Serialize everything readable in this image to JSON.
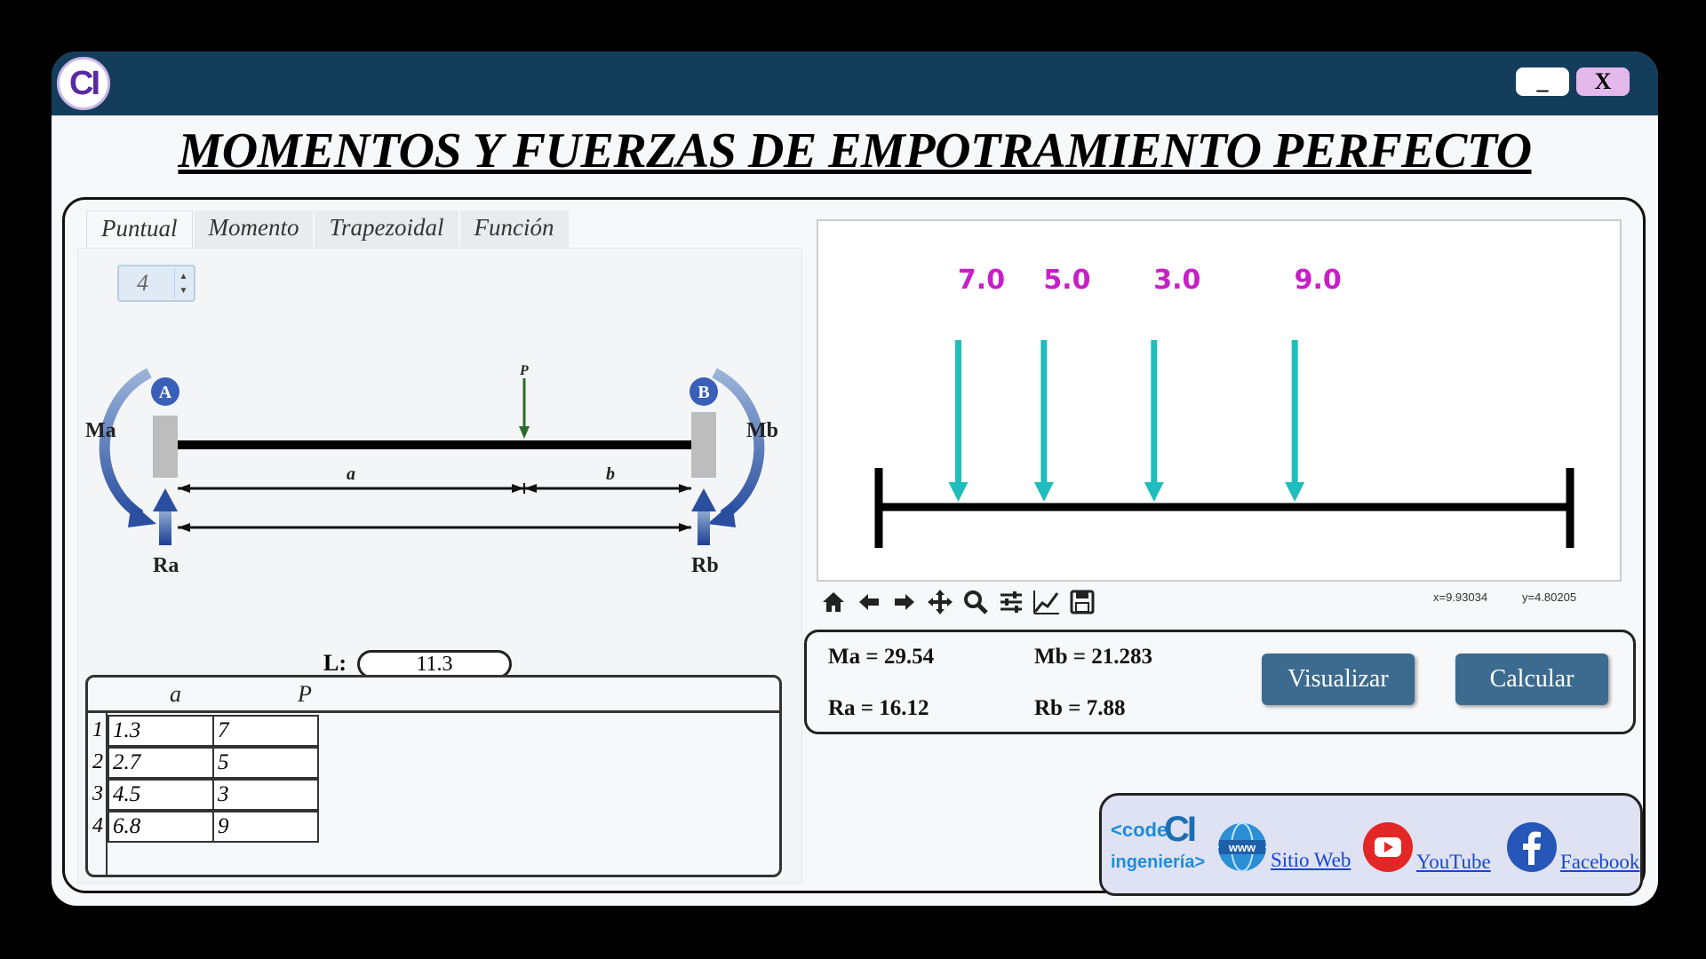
{
  "window": {
    "logo_text": "CI",
    "min_label": "_",
    "close_label": "X"
  },
  "title": "MOMENTOS Y FUERZAS DE EMPOTRAMIENTO PERFECTO",
  "tabs": [
    "Puntual",
    "Momento",
    "Trapezoidal",
    "Función"
  ],
  "active_tab": "Puntual",
  "spinbox": {
    "value": "4"
  },
  "diagram": {
    "support_a": "A",
    "support_b": "B",
    "moment_a": "Ma",
    "moment_b": "Mb",
    "reaction_a": "Ra",
    "reaction_b": "Rb",
    "load_label": "P",
    "dim_a": "a",
    "dim_b": "b",
    "length_label": "L:",
    "length_value": "11.3"
  },
  "table": {
    "headers": [
      "a",
      "P"
    ],
    "rows": [
      {
        "num": "1",
        "a": "1.3",
        "p": "7"
      },
      {
        "num": "2",
        "a": "2.7",
        "p": "5"
      },
      {
        "num": "3",
        "a": "4.5",
        "p": "3"
      },
      {
        "num": "4",
        "a": "6.8",
        "p": "9"
      }
    ]
  },
  "plot": {
    "beam_length": 11.3,
    "loads": [
      {
        "x": 1.3,
        "label": "7.0"
      },
      {
        "x": 2.7,
        "label": "5.0"
      },
      {
        "x": 4.5,
        "label": "3.0"
      },
      {
        "x": 6.8,
        "label": "9.0"
      }
    ],
    "load_color": "#1fbdbd",
    "label_color": "#c81ec8",
    "coord_x": "x=9.93034",
    "coord_y": "y=4.80205"
  },
  "toolbar": [
    "home-icon",
    "back-arrow-icon",
    "forward-arrow-icon",
    "pan-icon",
    "zoom-icon",
    "configure-icon",
    "line-edit-icon",
    "save-icon"
  ],
  "results": {
    "ma": "Ma = 29.54",
    "mb": "Mb = 21.283",
    "ra": "Ra = 16.12",
    "rb": "Rb = 7.88",
    "visualize_label": "Visualizar",
    "calculate_label": "Calcular"
  },
  "social": {
    "brand_top": "<code",
    "brand_ci": "CI",
    "brand_bottom": "ingeniería>",
    "website_label": "Sitio Web",
    "youtube_label": "YouTube",
    "facebook_label": "Facebook"
  }
}
